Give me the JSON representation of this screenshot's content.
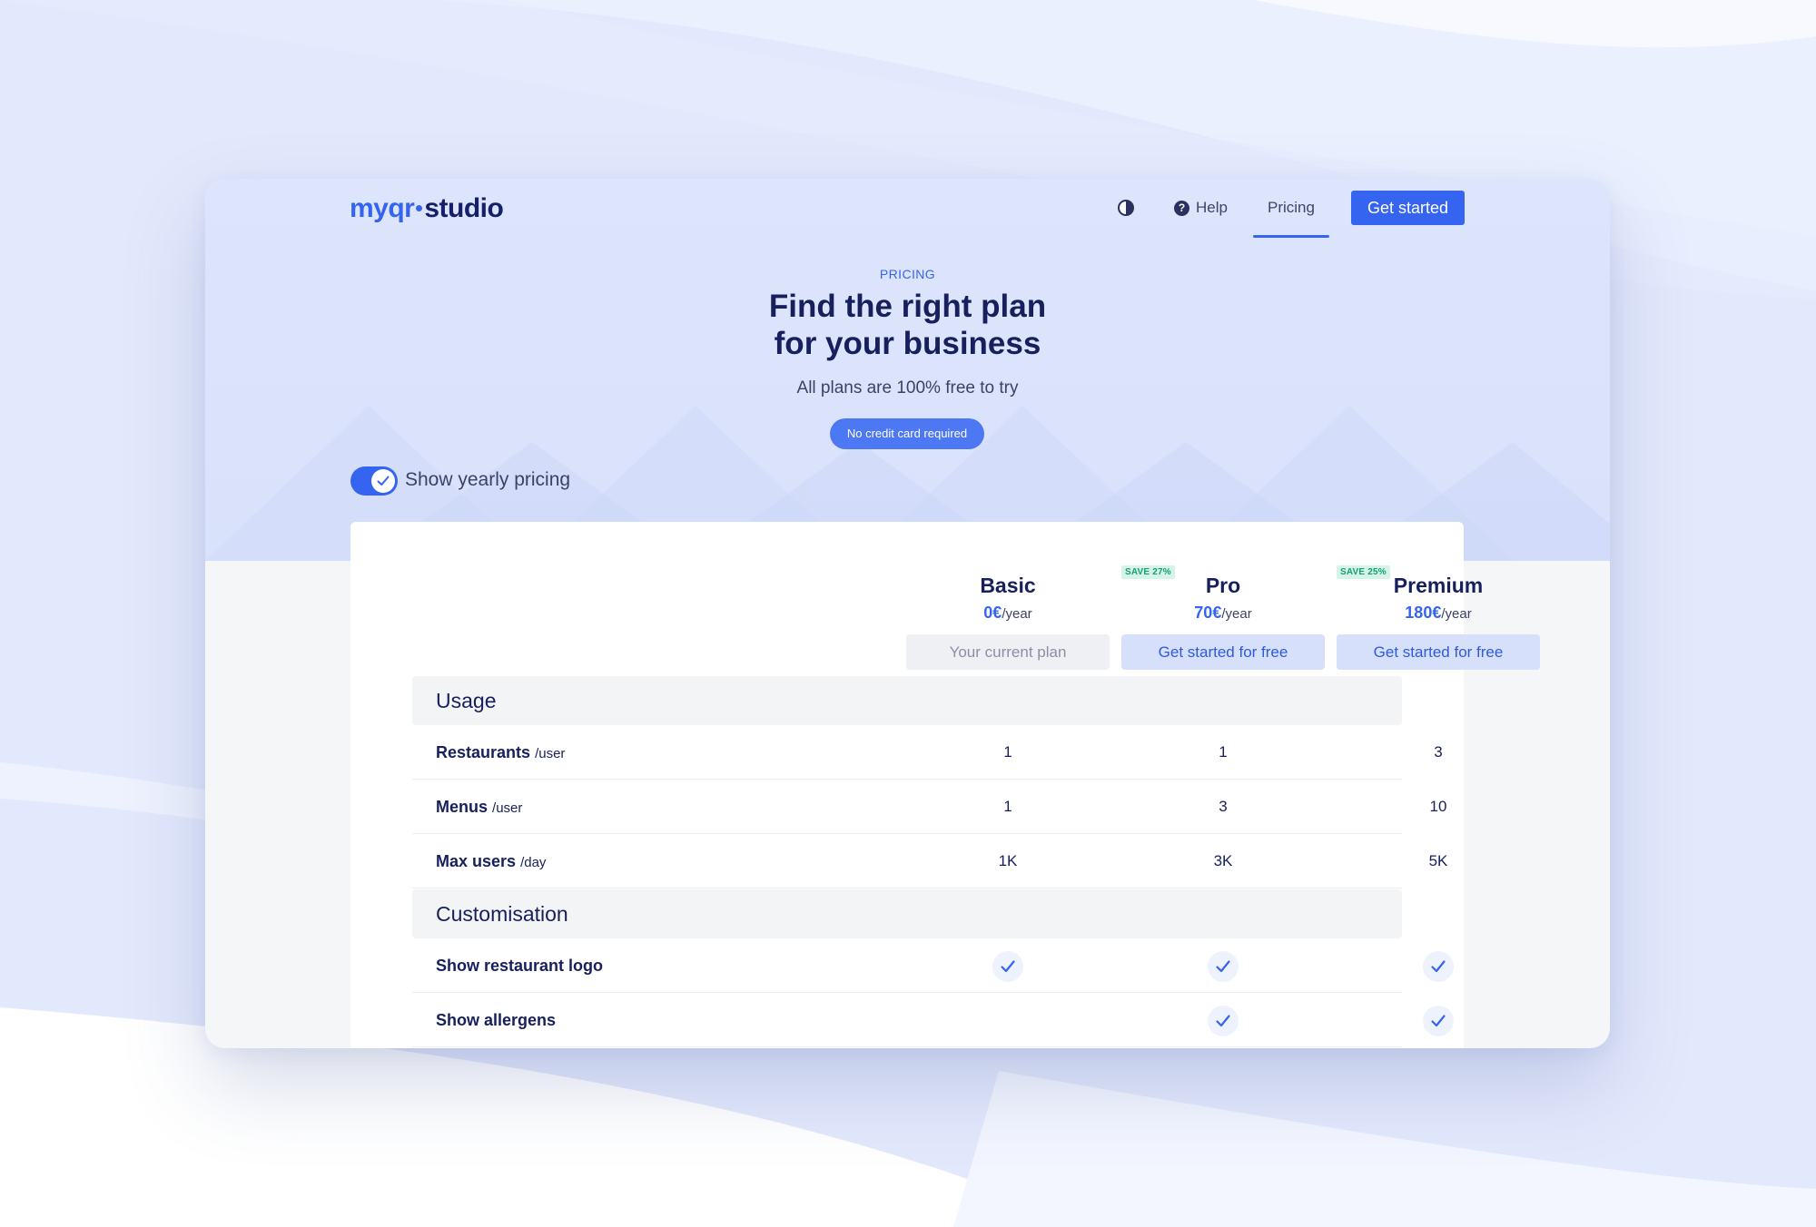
{
  "brand": {
    "logo_part1": "myqr",
    "logo_part2": "studio"
  },
  "nav": {
    "help": "Help",
    "pricing": "Pricing",
    "cta": "Get started"
  },
  "hero": {
    "eyebrow": "PRICING",
    "headline_line1": "Find the right plan",
    "headline_line2": "for your business",
    "subhead": "All plans are 100% free to try",
    "pill": "No credit card required",
    "toggle_label": "Show yearly pricing",
    "toggle_on": true
  },
  "plans": [
    {
      "name": "Basic",
      "price": "0€",
      "period": "/year",
      "button": "Your current plan",
      "save": ""
    },
    {
      "name": "Pro",
      "price": "70€",
      "period": "/year",
      "button": "Get started for free",
      "save": "SAVE 27%"
    },
    {
      "name": "Premium",
      "price": "180€",
      "period": "/year",
      "button": "Get started for free",
      "save": "SAVE 25%"
    }
  ],
  "sections": {
    "usage": "Usage",
    "customisation": "Customisation"
  },
  "rows": {
    "restaurants": {
      "label": "Restaurants",
      "unit": "/user",
      "values": [
        "1",
        "1",
        "3"
      ]
    },
    "menus": {
      "label": "Menus",
      "unit": "/user",
      "values": [
        "1",
        "3",
        "10"
      ]
    },
    "max_users": {
      "label": "Max users",
      "unit": "/day",
      "values": [
        "1K",
        "3K",
        "5K"
      ]
    },
    "logo": {
      "label": "Show restaurant logo",
      "checks": [
        true,
        true,
        true
      ]
    },
    "allergens": {
      "label": "Show allergens",
      "checks": [
        false,
        true,
        true
      ]
    }
  },
  "colors": {
    "accent": "#3564f1",
    "navy": "#17205c",
    "save_green": "#13a271"
  },
  "icons": [
    "theme-contrast-icon",
    "help-question-icon",
    "check-icon"
  ]
}
